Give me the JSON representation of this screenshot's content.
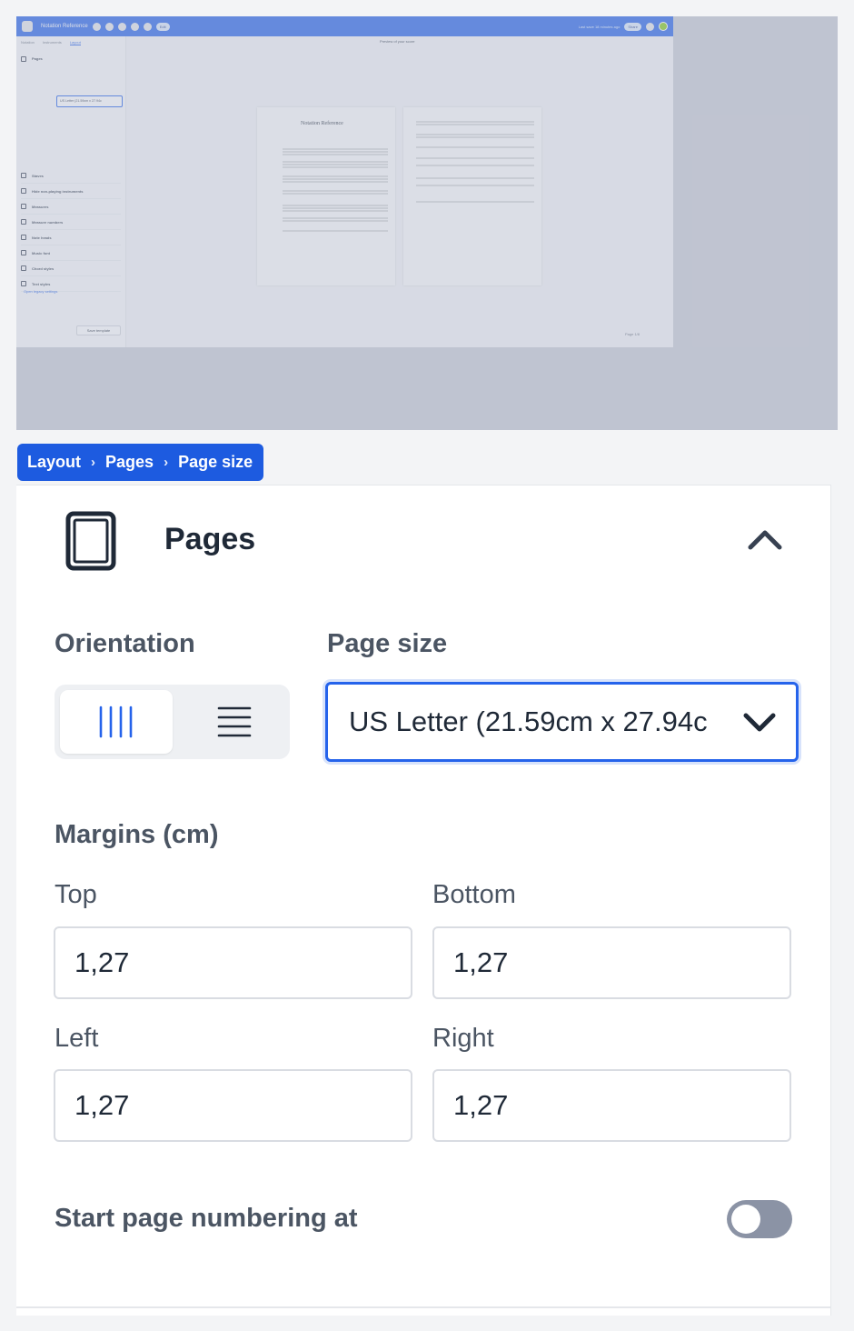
{
  "overview": {
    "app_title": "Notation Reference",
    "edit_label": "Edit",
    "last_save": "Last save 18 minutes ago",
    "share_label": "Share",
    "tabs": [
      "Notation",
      "Instruments",
      "Layout"
    ],
    "active_tab": "Layout",
    "page_size_value": "US Letter (21.59cm x 27.94c",
    "sections": [
      "Pages",
      "Staves",
      "Hide non-playing instruments",
      "Measures",
      "Measure numbers",
      "Note heads",
      "Music font",
      "Chord styles",
      "Text styles"
    ],
    "legacy_link": "Open legacy settings",
    "save_template": "Save template",
    "preview_label": "Preview of your score",
    "score_title": "Notation Reference",
    "page_nav": "Page 1/8"
  },
  "breadcrumb": {
    "items": [
      "Layout",
      "Pages",
      "Page size"
    ],
    "separator": "›"
  },
  "panel": {
    "section_title": "Pages",
    "orientation_label": "Orientation",
    "orientation_selected": "portrait",
    "page_size_label": "Page size",
    "page_size_value": "US Letter (21.59cm x 27.94c",
    "margins_label": "Margins (cm)",
    "margins": {
      "top_label": "Top",
      "top_value": "1,27",
      "bottom_label": "Bottom",
      "bottom_value": "1,27",
      "left_label": "Left",
      "left_value": "1,27",
      "right_label": "Right",
      "right_value": "1,27"
    },
    "start_numbering_label": "Start page numbering at",
    "start_numbering_enabled": false
  },
  "colors": {
    "accent": "#2563eb",
    "breadcrumb_bg": "#1d5be0",
    "toggle_off": "#8b93a5",
    "label_text": "#4b5563"
  },
  "icons": [
    "page-frame-icon",
    "chevron-up-icon",
    "portrait-orientation-icon",
    "landscape-orientation-icon",
    "chevron-down-icon"
  ]
}
